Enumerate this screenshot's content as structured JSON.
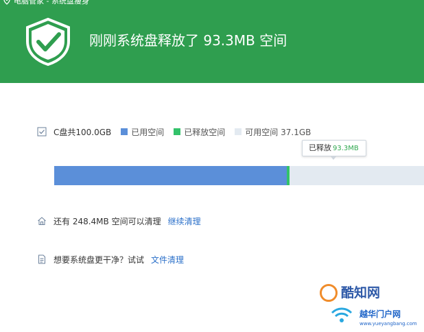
{
  "header": {
    "breadcrumb": "电脑管家 - 系统盘瘦身",
    "headline": "刚刚系统盘释放了 93.3MB 空间",
    "color": "#2f9e4f"
  },
  "disk": {
    "total_label": "C盘共100.0GB",
    "legend": {
      "used": "已用空间",
      "freed": "已释放空间",
      "free": "可用空间 37.1GB"
    },
    "colors": {
      "used": "#5b8fd9",
      "freed": "#33c26a",
      "free": "#e3eaf1"
    },
    "used_fraction": 0.629
  },
  "tooltip": {
    "label": "已释放",
    "value": "93.3MB"
  },
  "rows": {
    "remaining_text": "还有 248.4MB 空间可以清理",
    "remaining_link": "继续清理",
    "clean_text": "想要系统盘更干净？试试",
    "clean_link": "文件清理"
  },
  "watermark": {
    "line1": "酷知网",
    "line2": "越华门户网",
    "line3": "www.yueyangbang.com"
  }
}
